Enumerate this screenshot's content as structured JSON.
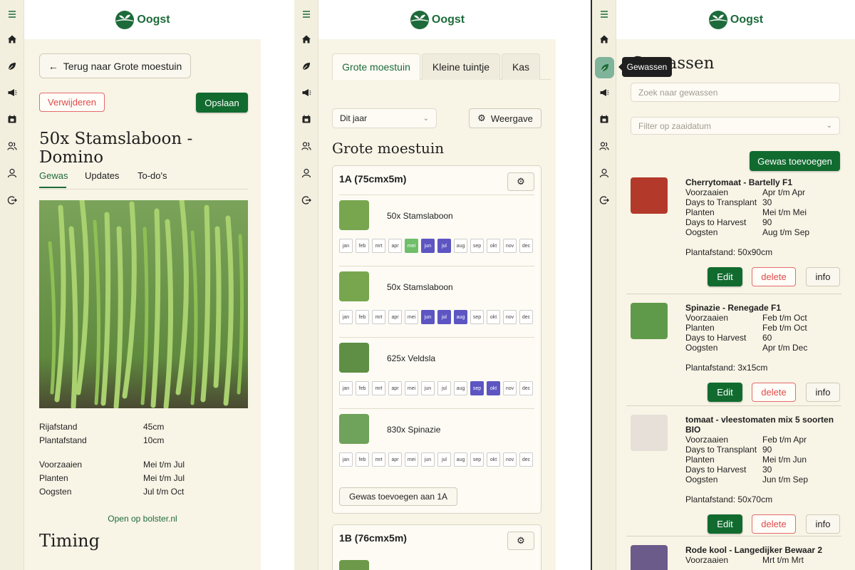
{
  "brand": {
    "name": "Oogst",
    "green": "#116b2f",
    "panel_bg": "#f8f4e6"
  },
  "rail_icons": [
    "hamburger-icon",
    "home-icon",
    "leaf-icon",
    "megaphone-icon",
    "calendar-icon",
    "users-icon",
    "user-icon",
    "logout-icon"
  ],
  "detail": {
    "back_label": "Terug naar Grote moestuin",
    "delete_label": "Verwijderen",
    "save_label": "Opslaan",
    "title": "50x Stamslaboon - Domino",
    "tabs": [
      "Gewas",
      "Updates",
      "To-do's"
    ],
    "active_tab": "Gewas",
    "specs": [
      {
        "label": "Rijafstand",
        "value": "45cm"
      },
      {
        "label": "Plantafstand",
        "value": "10cm"
      }
    ],
    "timing_rows": [
      {
        "label": "Voorzaaien",
        "value": "Mei t/m Jul"
      },
      {
        "label": "Planten",
        "value": "Mei t/m Jul"
      },
      {
        "label": "Oogsten",
        "value": "Jul t/m Oct"
      }
    ],
    "bolster_link": "Open op bolster.nl",
    "timing_heading": "Timing"
  },
  "garden": {
    "tabs": [
      "Grote moestuin",
      "Kleine tuintje",
      "Kas"
    ],
    "active_tab": "Grote moestuin",
    "year_select": "Dit jaar",
    "view_button": "Weergave",
    "heading": "Grote moestuin",
    "months": [
      "jan",
      "feb",
      "mrt",
      "apr",
      "mei",
      "jun",
      "jul",
      "aug",
      "sep",
      "okt",
      "nov",
      "dec"
    ],
    "beds": [
      {
        "name": "1A (75cmx5m)",
        "crops": [
          {
            "name": "50x Stamslaboon",
            "green": [
              "mei"
            ],
            "purple": [
              "jun",
              "jul"
            ]
          },
          {
            "name": "50x Stamslaboon",
            "green": [],
            "purple": [
              "jun",
              "jul",
              "aug"
            ]
          },
          {
            "name": "625x Veldsla",
            "green": [],
            "purple": [
              "sep",
              "okt"
            ]
          },
          {
            "name": "830x Spinazie",
            "green": [],
            "purple": []
          }
        ],
        "add_button": "Gewas toevoegen aan 1A"
      },
      {
        "name": "1B (76cmx5m)"
      }
    ]
  },
  "crops": {
    "title": "Gewassen",
    "tooltip": "Gewassen",
    "search_placeholder": "Zoek naar gewassen",
    "filter_placeholder": "Filter op zaaidatum",
    "add_button": "Gewas toevoegen",
    "edit_label": "Edit",
    "delete_label": "delete",
    "info_label": "info",
    "list": [
      {
        "name": "Cherrytomaat - Bartelly F1",
        "rows": [
          {
            "label": "Voorzaaien",
            "value": "Apr t/m Apr"
          },
          {
            "label": "Days to Transplant",
            "value": "30"
          },
          {
            "label": "Planten",
            "value": "Mei t/m Mei"
          },
          {
            "label": "Days to Harvest",
            "value": "90"
          },
          {
            "label": "Oogsten",
            "value": "Aug t/m Sep"
          }
        ],
        "spacing": "Plantafstand: 50x90cm"
      },
      {
        "name": "Spinazie - Renegade F1",
        "rows": [
          {
            "label": "Voorzaaien",
            "value": "Feb t/m Oct"
          },
          {
            "label": "Planten",
            "value": "Feb t/m Oct"
          },
          {
            "label": "Days to Harvest",
            "value": "60"
          },
          {
            "label": "Oogsten",
            "value": "Apr t/m Dec"
          }
        ],
        "spacing": "Plantafstand: 3x15cm"
      },
      {
        "name": "tomaat - vleestomaten mix 5 soorten BIO",
        "rows": [
          {
            "label": "Voorzaaien",
            "value": "Feb t/m Apr"
          },
          {
            "label": "Days to Transplant",
            "value": "90"
          },
          {
            "label": "Planten",
            "value": "Mei t/m Jun"
          },
          {
            "label": "Days to Harvest",
            "value": "30"
          },
          {
            "label": "Oogsten",
            "value": "Jun t/m Sep"
          }
        ],
        "spacing": "Plantafstand: 50x70cm"
      },
      {
        "name": "Rode kool - Langedijker Bewaar 2",
        "rows": [
          {
            "label": "Voorzaaien",
            "value": "Mrt t/m Mrt"
          }
        ]
      }
    ]
  }
}
